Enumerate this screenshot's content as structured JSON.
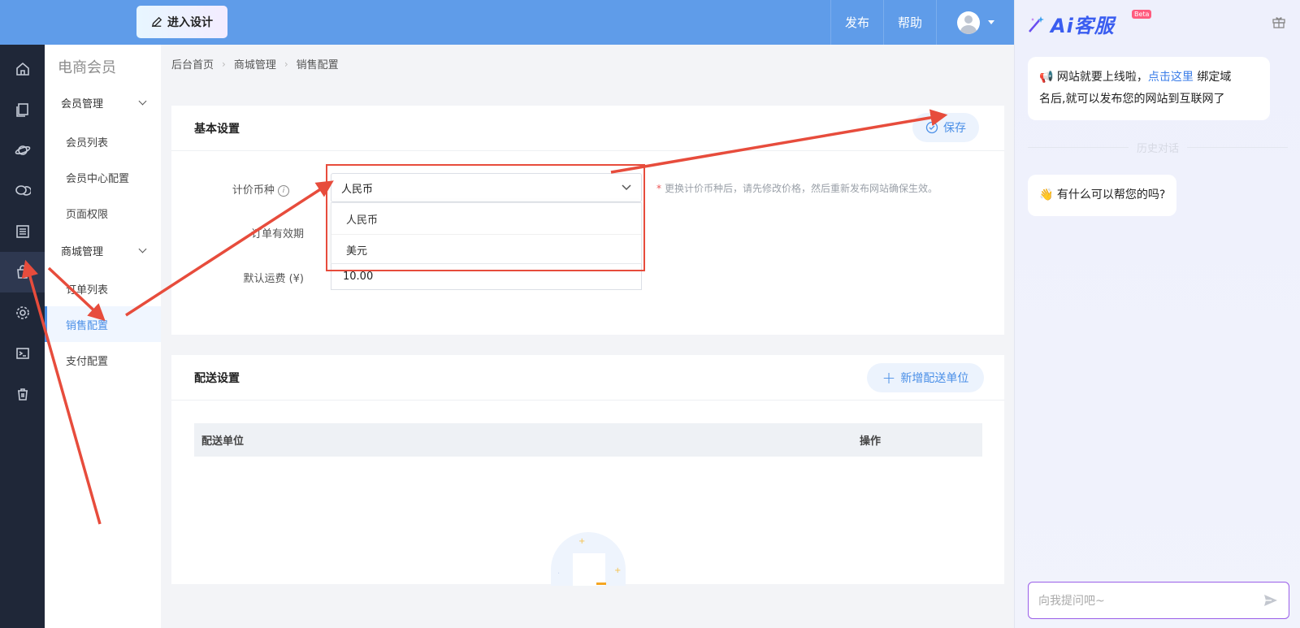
{
  "topbar": {
    "design_button": "进入设计",
    "publish": "发布",
    "help": "帮助"
  },
  "sidebar": {
    "title": "电商会员",
    "groups": [
      {
        "label": "会员管理",
        "items": [
          "会员列表",
          "会员中心配置",
          "页面权限"
        ]
      },
      {
        "label": "商城管理",
        "items": [
          "订单列表",
          "销售配置",
          "支付配置"
        ]
      }
    ],
    "active_item": "销售配置"
  },
  "breadcrumb": [
    "后台首页",
    "商城管理",
    "销售配置"
  ],
  "basic_settings": {
    "title": "基本设置",
    "save_label": "保存",
    "currency_label": "计价币种",
    "currency_value": "人民币",
    "currency_options": [
      "人民币",
      "美元"
    ],
    "currency_hint": "更换计价币种后，请先修改价格，然后重新发布网站确保生效。",
    "hint_star": "*",
    "order_validity_label": "订单有效期",
    "shipping_fee_label": "默认运费 (¥)",
    "shipping_fee_value": "10.00"
  },
  "delivery_settings": {
    "title": "配送设置",
    "add_label": "新增配送单位",
    "columns": [
      "配送单位",
      "操作"
    ]
  },
  "ai_panel": {
    "logo_text": "Ai客服",
    "beta": "Beta",
    "notice_prefix": "网站就要上线啦，",
    "notice_link": "点击这里",
    "notice_line1_suffix": " 绑定域",
    "notice_line2": "名后,就可以发布您的网站到互联网了",
    "history_label": "历史对话",
    "greeting": "有什么可以帮您的吗?",
    "input_placeholder": "向我提问吧~"
  },
  "colors": {
    "topbar": "#5f9ce9",
    "rail": "#1f2738",
    "accent": "#4a8fe7",
    "annotation": "#e74c3c"
  }
}
